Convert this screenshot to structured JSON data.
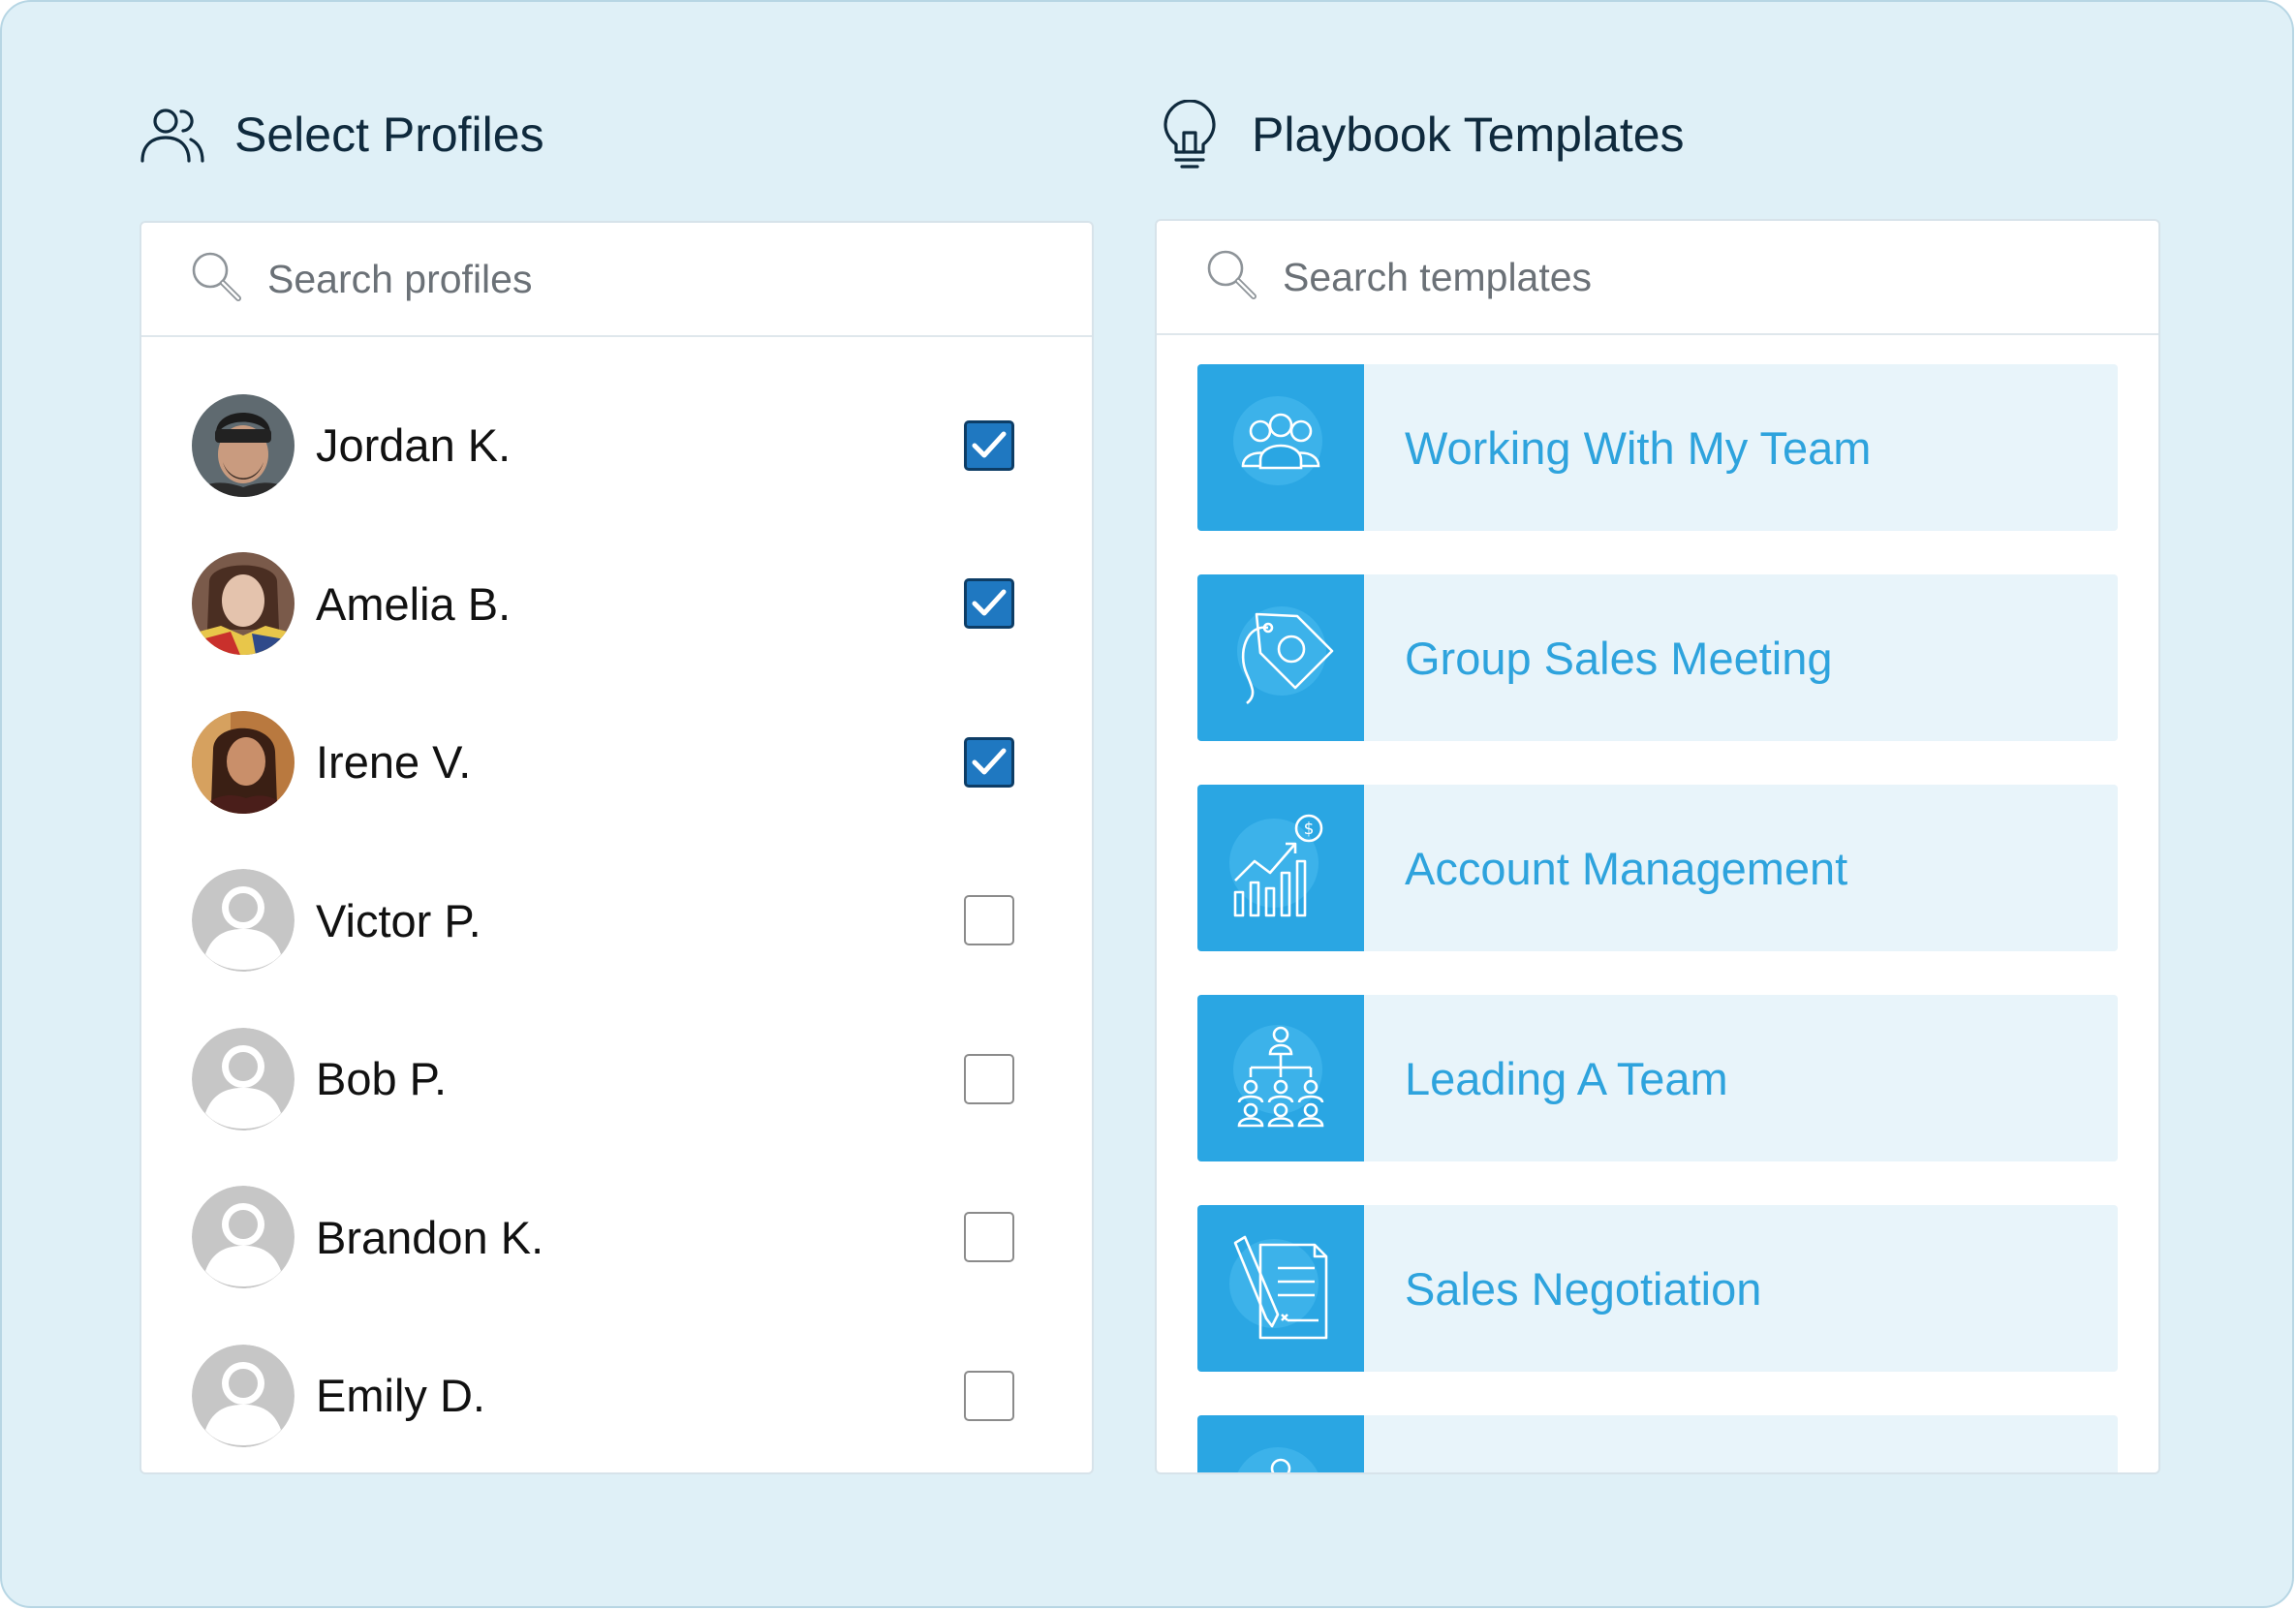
{
  "profiles_section": {
    "title": "Select Profiles",
    "search_placeholder": "Search profiles",
    "items": [
      {
        "name": "Jordan K.",
        "checked": true,
        "avatar": "photo"
      },
      {
        "name": "Amelia B.",
        "checked": true,
        "avatar": "photo"
      },
      {
        "name": "Irene V.",
        "checked": true,
        "avatar": "photo"
      },
      {
        "name": "Victor P.",
        "checked": false,
        "avatar": "placeholder"
      },
      {
        "name": "Bob P.",
        "checked": false,
        "avatar": "placeholder"
      },
      {
        "name": "Brandon K.",
        "checked": false,
        "avatar": "placeholder"
      },
      {
        "name": "Emily D.",
        "checked": false,
        "avatar": "placeholder"
      }
    ]
  },
  "templates_section": {
    "title": "Playbook Templates",
    "search_placeholder": "Search templates",
    "items": [
      {
        "title": "Working With My Team",
        "icon": "team-icon"
      },
      {
        "title": "Group Sales Meeting",
        "icon": "price-tag-icon"
      },
      {
        "title": "Account Management",
        "icon": "growth-chart-icon"
      },
      {
        "title": "Leading A Team",
        "icon": "org-chart-icon"
      },
      {
        "title": "Sales Negotiation",
        "icon": "contract-icon"
      },
      {
        "title": "",
        "icon": "partial-icon"
      }
    ]
  },
  "colors": {
    "background": "#dff0f7",
    "accent": "#2aa6e3",
    "checkbox_checked": "#1f78c1",
    "heading_text": "#0f2a3d"
  }
}
